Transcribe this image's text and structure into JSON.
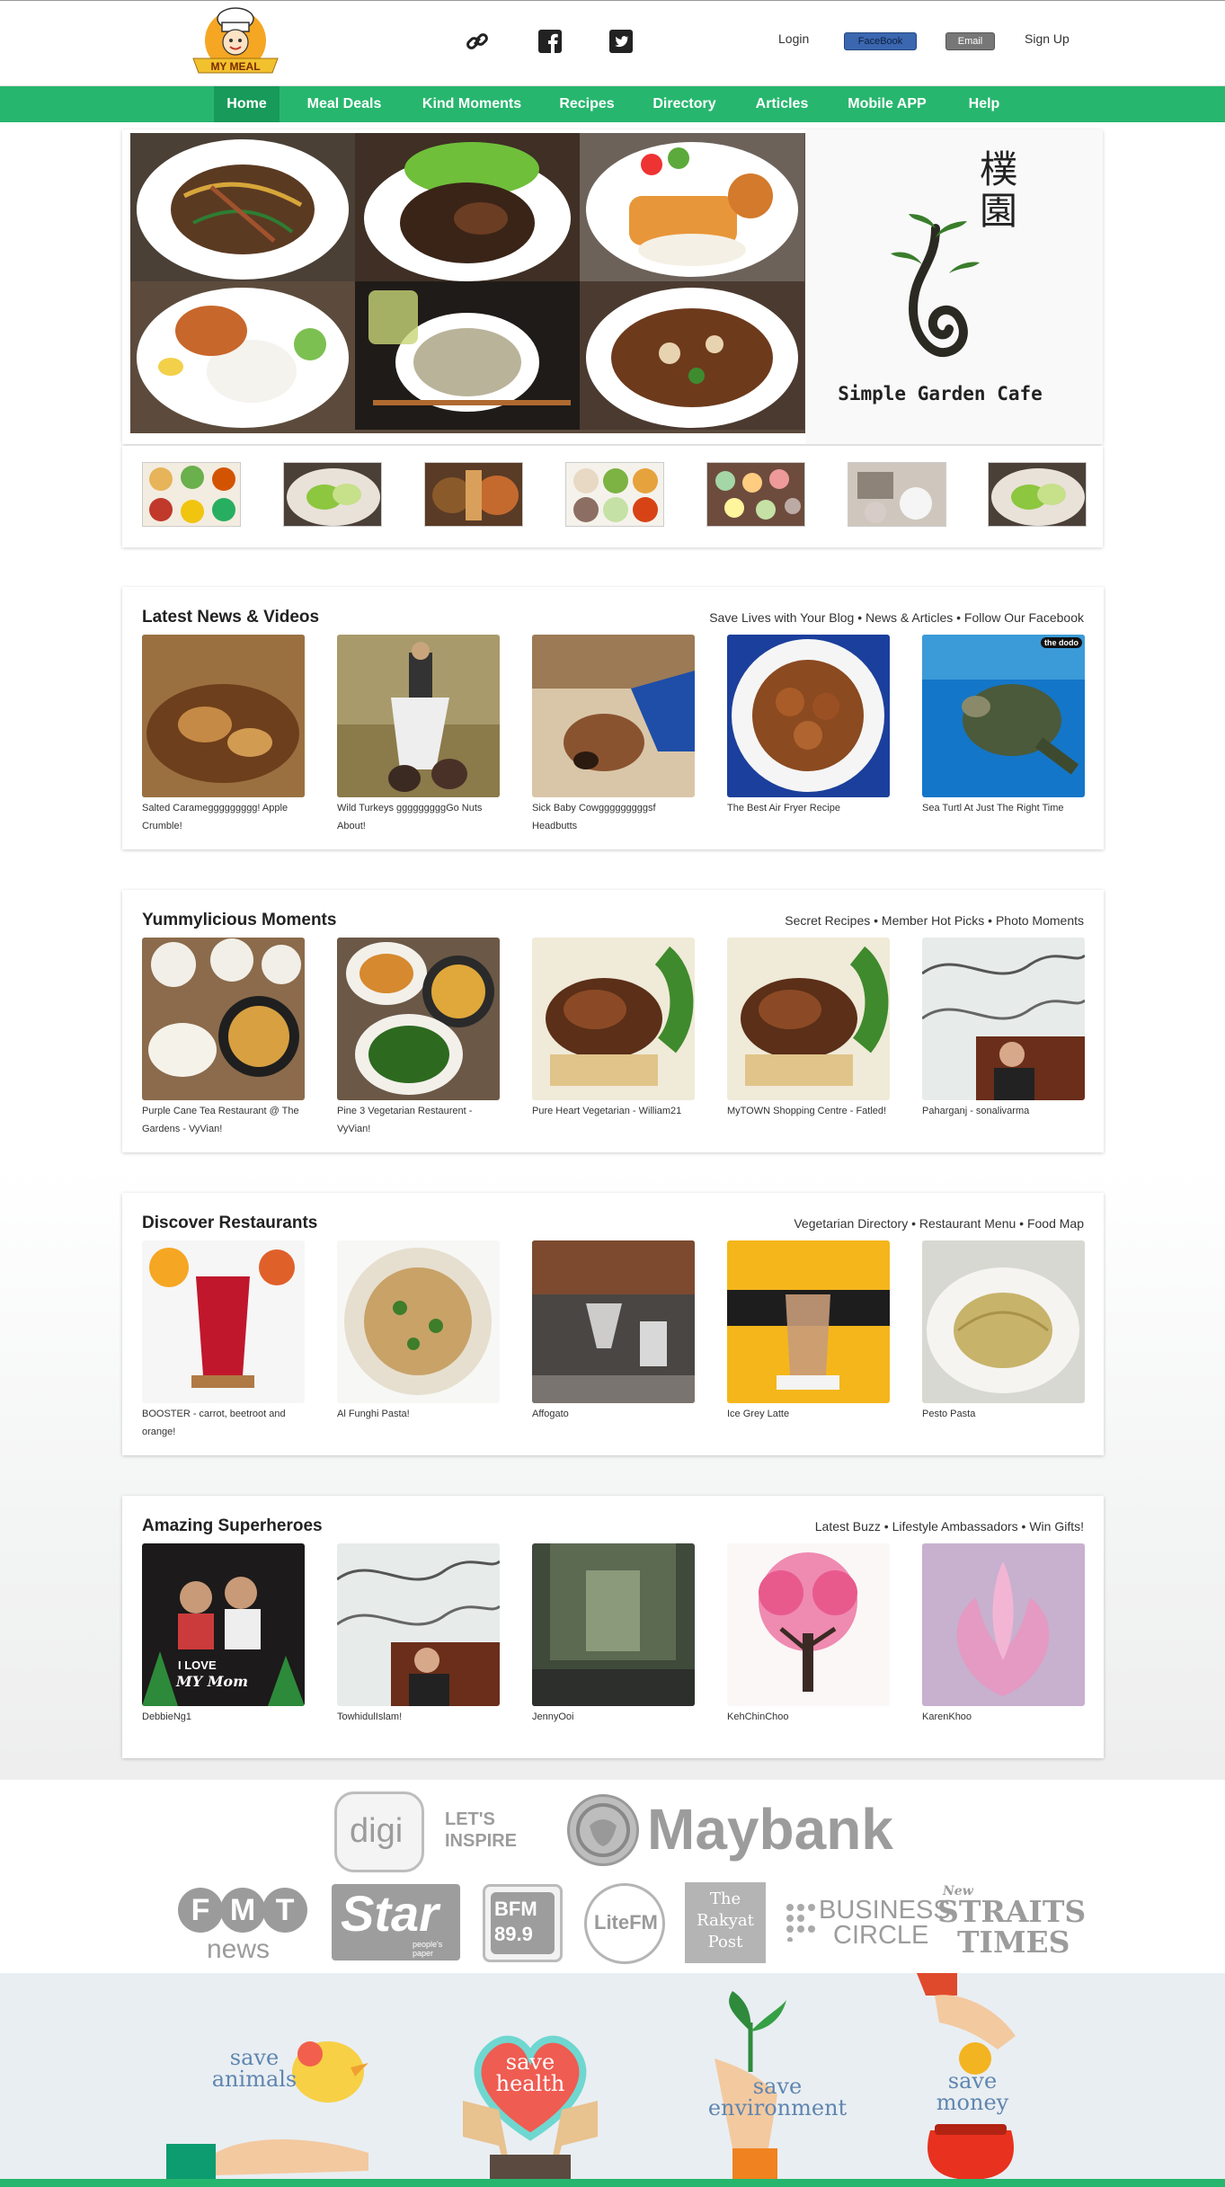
{
  "header": {
    "logo_text": "MY MEAL",
    "social_icons": [
      "link-icon",
      "facebook-icon",
      "twitter-icon"
    ],
    "login_label": "Login",
    "facebook_label": "FaceBook",
    "email_label": "Email",
    "signup_label": "Sign Up"
  },
  "nav": {
    "items": [
      {
        "label": "Home",
        "active": true
      },
      {
        "label": "Meal Deals"
      },
      {
        "label": "Kind Moments"
      },
      {
        "label": "Recipes"
      },
      {
        "label": "Directory"
      },
      {
        "label": "Articles"
      },
      {
        "label": "Mobile APP"
      },
      {
        "label": "Help"
      }
    ]
  },
  "hero": {
    "brand_chinese_1": "樸",
    "brand_chinese_2": "園",
    "brand_name": "Simple Garden Cafe"
  },
  "sections": [
    {
      "title": "Latest News & Videos",
      "links": "Save Lives with Your Blog • News & Articles • Follow Our Facebook",
      "cards": [
        {
          "caption": "Salted Carameggggggggg! Apple Crumble!"
        },
        {
          "caption": "Wild Turkeys gggggggggGo Nuts About!"
        },
        {
          "caption": "Sick Baby Cowgggggggggsf Headbutts"
        },
        {
          "caption": "The Best Air Fryer Recipe"
        },
        {
          "caption": "Sea Turtl At Just The Right Time",
          "badge": "the dodo"
        }
      ]
    },
    {
      "title": "Yummylicious Moments",
      "links": "Secret Recipes • Member Hot Picks • Photo Moments",
      "cards": [
        {
          "caption": "Purple Cane Tea Restaurant @ The Gardens - VyVian!"
        },
        {
          "caption": "Pine 3 Vegetarian Restaurent - VyVian!"
        },
        {
          "caption": "Pure Heart Vegetarian - William21"
        },
        {
          "caption": "MyTOWN Shopping Centre - Fatled!"
        },
        {
          "caption": "Paharganj - sonalivarma"
        }
      ]
    },
    {
      "title": "Discover Restaurants",
      "links": "Vegetarian Directory • Restaurant Menu • Food Map",
      "cards": [
        {
          "caption": "BOOSTER - carrot, beetroot and orange!"
        },
        {
          "caption": "Al Funghi Pasta!"
        },
        {
          "caption": "Affogato"
        },
        {
          "caption": "Ice Grey Latte"
        },
        {
          "caption": "Pesto Pasta"
        }
      ]
    },
    {
      "title": "Amazing Superheroes",
      "links": "Latest Buzz • Lifestyle Ambassadors • Win Gifts!",
      "cards": [
        {
          "caption": "DebbieNg1",
          "overlay_1": "I LOVE",
          "overlay_2": "MY Mom"
        },
        {
          "caption": "TowhidulIslam!"
        },
        {
          "caption": "JennyOoi"
        },
        {
          "caption": "KehChinChoo"
        },
        {
          "caption": "KarenKhoo"
        }
      ]
    }
  ],
  "sponsors": {
    "digi": "digi",
    "digi_slogan_1": "LET'S",
    "digi_slogan_2": "INSPIRE",
    "maybank": "Maybank",
    "fmt_1": "F",
    "fmt_2": "M",
    "fmt_3": "T",
    "fmt_news": "news",
    "star": "Star",
    "star_sub": "people's paper",
    "bfm_1": "BFM",
    "bfm_2": "89.9",
    "litefm": "LiteFM",
    "rakyat_1": "The",
    "rakyat_2": "Rakyat",
    "rakyat_3": "Post",
    "business_1": "BUSINESS",
    "business_2": "CIRCLE",
    "nst_1": "New",
    "nst_2": "STRAITS",
    "nst_3": "TIMES"
  },
  "save": {
    "animals_1": "save",
    "animals_2": "animals",
    "health_1": "save",
    "health_2": "health",
    "environment_1": "save",
    "environment_2": "environment",
    "money_1": "save",
    "money_2": "money"
  },
  "colors": {
    "nav_green": "#27b66e",
    "nav_active": "#179a5a",
    "facebook_pill": "#3b67b0",
    "email_pill": "#777777",
    "save_text": "#5f86b0"
  }
}
